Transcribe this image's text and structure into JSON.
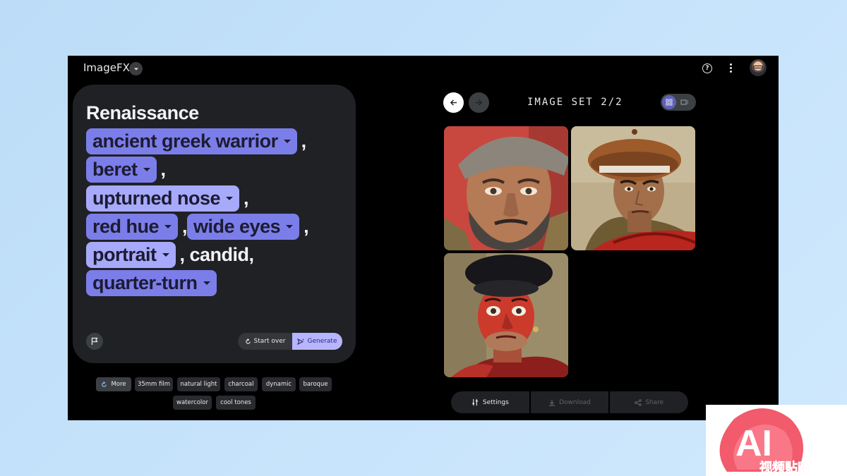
{
  "app": {
    "title": "ImageFX"
  },
  "prompt": {
    "lines": [
      [
        {
          "type": "text",
          "text": "Renaissance"
        }
      ],
      [
        {
          "type": "chip",
          "text": "ancient greek warrior",
          "tone": "purple"
        },
        {
          "type": "comma",
          "text": ","
        }
      ],
      [
        {
          "type": "chip",
          "text": "beret",
          "tone": "purple"
        },
        {
          "type": "comma",
          "text": ","
        }
      ],
      [
        {
          "type": "chip",
          "text": "upturned nose",
          "tone": "light"
        },
        {
          "type": "comma",
          "text": ","
        }
      ],
      [
        {
          "type": "chip",
          "text": "red hue",
          "tone": "purple"
        },
        {
          "type": "comma",
          "text": ","
        },
        {
          "type": "chip",
          "text": "wide eyes",
          "tone": "purple"
        },
        {
          "type": "comma",
          "text": ","
        }
      ],
      [
        {
          "type": "chip",
          "text": "portrait",
          "tone": "light"
        },
        {
          "type": "plain",
          "text": ", candid,"
        }
      ],
      [
        {
          "type": "chip",
          "text": "quarter-turn",
          "tone": "purple"
        }
      ]
    ],
    "start_over_label": "Start over",
    "generate_label": "Generate"
  },
  "suggestions": {
    "more_label": "More",
    "chips": [
      "35mm film",
      "natural light",
      "charcoal",
      "dynamic",
      "baroque",
      "watercolor",
      "cool tones"
    ]
  },
  "gallery": {
    "set_label": "IMAGE SET 2/2",
    "images": [
      {
        "subject": "bearded man in grey cap"
      },
      {
        "subject": "man in brown beret with red cloak"
      },
      {
        "subject": "man with red painted face in black beret"
      }
    ]
  },
  "actions": {
    "settings_label": "Settings",
    "download_label": "Download",
    "share_label": "Share"
  },
  "watermark": {
    "logo_text": "AI",
    "caption": "视频贴吧"
  },
  "colors": {
    "chip_purple": "#7b7ee8",
    "chip_light": "#a7aafb",
    "generate_bg": "#b7b5ff",
    "card_bg": "#202124"
  }
}
